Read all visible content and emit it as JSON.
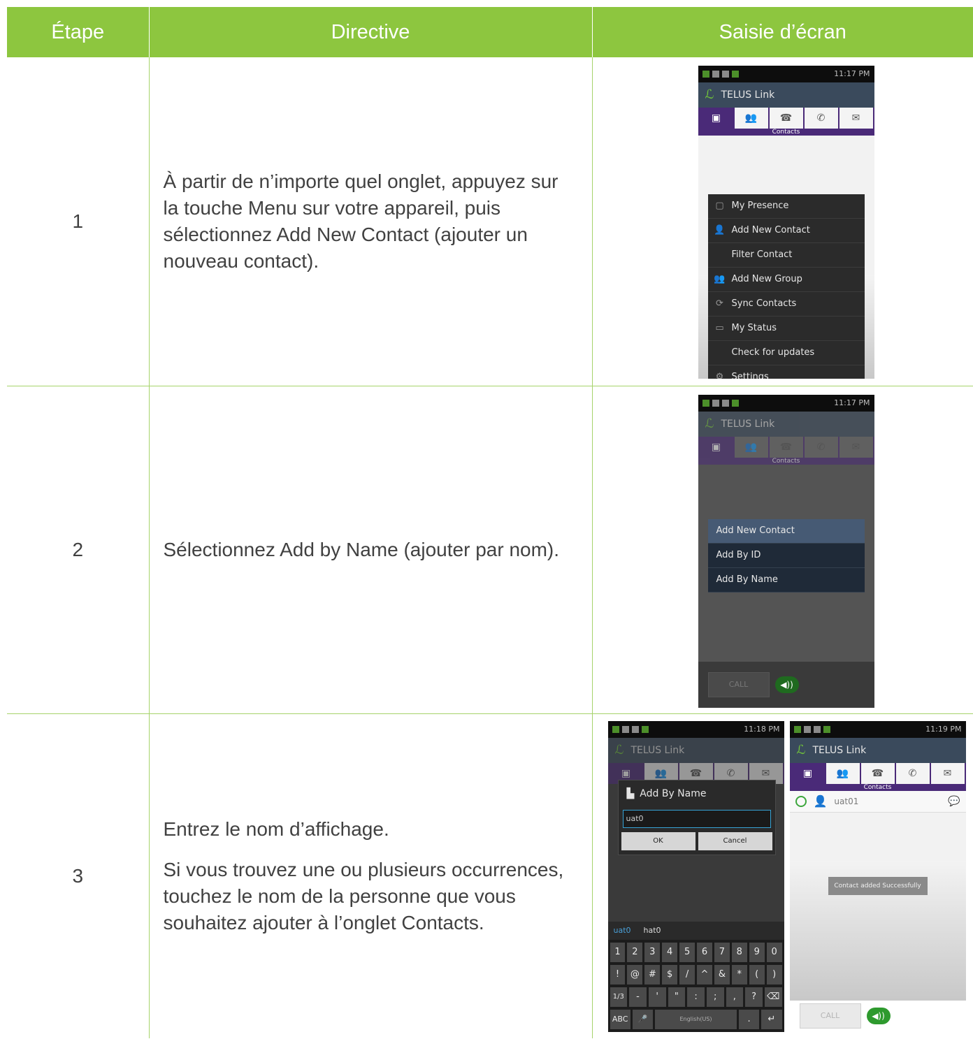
{
  "table": {
    "headers": [
      "Étape",
      "Directive",
      "Saisie d’écran"
    ],
    "rows": [
      {
        "step": "1",
        "directive": [
          "À partir de n’importe quel onglet, appuyez sur la touche Menu sur votre appareil, puis sélectionnez Add New Contact (ajouter un nouveau contact)."
        ]
      },
      {
        "step": "2",
        "directive": [
          "Sélectionnez Add by Name (ajouter par nom)."
        ]
      },
      {
        "step": "3",
        "directive": [
          "Entrez le nom d’affichage.",
          "Si vous trouvez une ou plusieurs occurrences, touchez le nom de la personne que vous souhaitez ajouter à l’onglet Contacts."
        ]
      }
    ]
  },
  "phone": {
    "app_title": "TELUS Link",
    "tab_caption": "Contacts",
    "times": [
      "11:17 PM",
      "11:17 PM",
      "11:18 PM",
      "11:19 PM"
    ],
    "menu_items": [
      "My Presence",
      "Add New Contact",
      "Filter Contact",
      "Add New Group",
      "Sync Contacts",
      "My Status",
      "Check for updates",
      "Settings"
    ],
    "add_popup": {
      "title": "Add New Contact",
      "items": [
        "Add By ID",
        "Add By Name"
      ]
    },
    "call_label": "CALL",
    "dialog": {
      "title": "Add By Name",
      "input_value": "uat0",
      "ok": "OK",
      "cancel": "Cancel"
    },
    "keyboard": {
      "suggestions": [
        "uat0",
        "hat0"
      ],
      "row1": [
        "1",
        "2",
        "3",
        "4",
        "5",
        "6",
        "7",
        "8",
        "9",
        "0"
      ],
      "row2": [
        "!",
        "@",
        "#",
        "$",
        "/",
        "^",
        "&",
        "*",
        "(",
        ")"
      ],
      "row3": [
        "1/3",
        "-",
        "'",
        "\"",
        ":",
        ";",
        ",",
        "?",
        "⌫"
      ],
      "row4": [
        "ABC",
        "🎤",
        "English(US)",
        ".",
        "↵"
      ]
    },
    "contact_name": "uat01",
    "toast": "Contact added Successfully"
  }
}
